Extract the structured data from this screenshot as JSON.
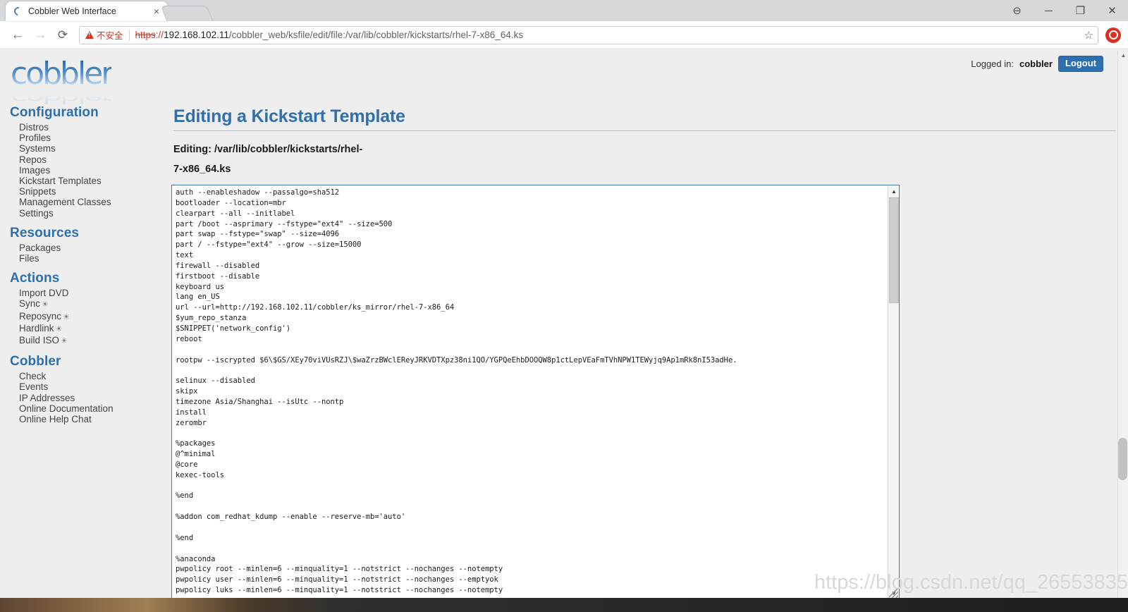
{
  "browser": {
    "tab": {
      "title": "Cobbler Web Interface",
      "close_label": "×",
      "favicon": "cobbler-favicon"
    },
    "window_controls": {
      "account": "⊖",
      "minimize": "─",
      "maximize": "❐",
      "close": "✕"
    },
    "nav": {
      "back": "←",
      "forward": "→",
      "reload": "⟳"
    },
    "omnibox": {
      "security_label": "不安全",
      "scheme": "https",
      "separator": "://",
      "host": "192.168.102.11",
      "path": "/cobbler_web/ksfile/edit/file:/var/lib/cobbler/kickstarts/rhel-7-x86_64.ks",
      "full_url": "https://192.168.102.11/cobbler_web/ksfile/edit/file:/var/lib/cobbler/kickstarts/rhel-7-x86_64.ks",
      "bookmark_star": "☆"
    }
  },
  "header": {
    "logo_text": "cobbler",
    "logged_in_label": "Logged in:",
    "username": "cobbler",
    "logout_label": "Logout"
  },
  "sidebar": {
    "sections": [
      {
        "title": "Configuration",
        "items": [
          {
            "label": "Distros",
            "gear": false
          },
          {
            "label": "Profiles",
            "gear": false
          },
          {
            "label": "Systems",
            "gear": false
          },
          {
            "label": "Repos",
            "gear": false
          },
          {
            "label": "Images",
            "gear": false
          },
          {
            "label": "Kickstart Templates",
            "gear": false
          },
          {
            "label": "Snippets",
            "gear": false
          },
          {
            "label": "Management Classes",
            "gear": false
          },
          {
            "label": "Settings",
            "gear": false
          }
        ]
      },
      {
        "title": "Resources",
        "items": [
          {
            "label": "Packages",
            "gear": false
          },
          {
            "label": "Files",
            "gear": false
          }
        ]
      },
      {
        "title": "Actions",
        "items": [
          {
            "label": "Import DVD",
            "gear": false
          },
          {
            "label": "Sync",
            "gear": true
          },
          {
            "label": "Reposync",
            "gear": true
          },
          {
            "label": "Hardlink",
            "gear": true
          },
          {
            "label": "Build ISO",
            "gear": true
          }
        ]
      },
      {
        "title": "Cobbler",
        "items": [
          {
            "label": "Check",
            "gear": false
          },
          {
            "label": "Events",
            "gear": false
          },
          {
            "label": "IP Addresses",
            "gear": false
          },
          {
            "label": "Online Documentation",
            "gear": false
          },
          {
            "label": "Online Help Chat",
            "gear": false
          }
        ]
      }
    ],
    "gear_glyph": "☀"
  },
  "main": {
    "page_title": "Editing a Kickstart Template",
    "editing_label_line1": "Editing: /var/lib/cobbler/kickstarts/rhel-",
    "editing_label_line2": "7-x86_64.ks",
    "kickstart_content": "auth --enableshadow --passalgo=sha512\nbootloader --location=mbr\nclearpart --all --initlabel\npart /boot --asprimary --fstype=\"ext4\" --size=500\npart swap --fstype=\"swap\" --size=4096\npart / --fstype=\"ext4\" --grow --size=15000\ntext\nfirewall --disabled\nfirstboot --disable\nkeyboard us\nlang en_US\nurl --url=http://192.168.102.11/cobbler/ks_mirror/rhel-7-x86_64\n$yum_repo_stanza\n$SNIPPET('network_config')\nreboot\n\nrootpw --iscrypted $6\\$GS/XEy70viVUsRZJ\\$waZrzBWclEReyJRKVDTXpz38ni1QO/YGPQeEhbDOOQW8p1ctLepVEaFmTVhNPW1TEWyjq9Ap1mRk8nI53adHe.\n\nselinux --disabled\nskipx\ntimezone Asia/Shanghai --isUtc --nontp\ninstall\nzerombr\n\n%packages\n@^minimal\n@core\nkexec-tools\n\n%end\n\n%addon com_redhat_kdump --enable --reserve-mb='auto'\n\n%end\n\n%anaconda\npwpolicy root --minlen=6 --minquality=1 --notstrict --nochanges --notempty\npwpolicy user --minlen=6 --minquality=1 --notstrict --nochanges --emptyok\npwpolicy luks --minlen=6 --minquality=1 --notstrict --nochanges --notempty\n%end"
  },
  "watermark": {
    "text": "https://blog.csdn.net/qq_26553835"
  },
  "scrollbars": {
    "up_arrow": "▲",
    "down_arrow": "▼"
  },
  "colors": {
    "accent_blue": "#2e6fad",
    "warn_red": "#d93025",
    "page_bg": "#eeeeee",
    "text_dark": "#1c1c1c"
  }
}
